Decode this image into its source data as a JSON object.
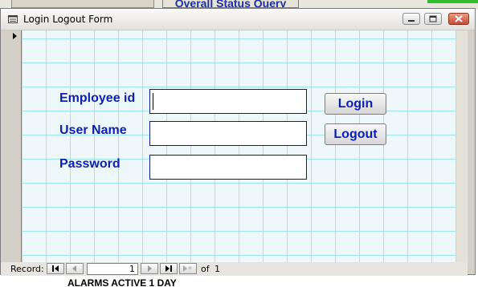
{
  "background": {
    "tab_title": "Overall Status Query",
    "bottom_text": "ALARMS ACTIVE 1 DAY"
  },
  "window": {
    "title": "Login Logout Form",
    "title_icon": "form-icon",
    "controls": [
      "minimize-icon",
      "maximize-icon",
      "close-icon"
    ]
  },
  "form": {
    "employee_id_label": "Employee id",
    "employee_id_value": "",
    "user_name_label": "User Name",
    "user_name_value": "",
    "password_label": "Password",
    "password_value": "",
    "login_label": "Login",
    "logout_label": "Logout"
  },
  "navigation": {
    "record_label": "Record:",
    "current_record": "1",
    "of_label": "of",
    "total_records": "1"
  },
  "colors": {
    "label_text": "#0b1fb3",
    "grid_line": "#9fe3ee",
    "field_border": "#0c1a86"
  }
}
